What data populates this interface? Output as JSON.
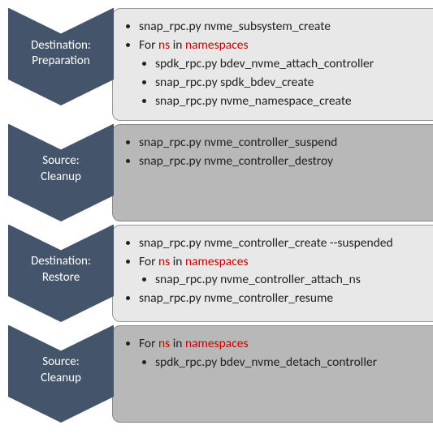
{
  "chevron_fill": "#44546a",
  "steps": [
    {
      "label": "Destination:\nPreparation",
      "box_tone": "light",
      "items": [
        {
          "text": "snap_rpc.py nvme_subsystem_create"
        },
        {
          "text_pre": "For ",
          "red1": "ns",
          "mid": " in ",
          "red2": "namespaces",
          "children": [
            {
              "text": "spdk_rpc.py bdev_nvme_attach_controller"
            },
            {
              "text": "snap_rpc.py spdk_bdev_create"
            },
            {
              "text": "snap_rpc.py nvme_namespace_create"
            }
          ]
        }
      ]
    },
    {
      "label": "Source:\nCleanup",
      "box_tone": "dark",
      "items": [
        {
          "text": "snap_rpc.py nvme_controller_suspend"
        },
        {
          "text": "snap_rpc.py nvme_controller_destroy"
        }
      ]
    },
    {
      "label": "Destination:\nRestore",
      "box_tone": "light",
      "items": [
        {
          "text": "snap_rpc.py nvme_controller_create --suspended"
        },
        {
          "text_pre": "For ",
          "red1": "ns",
          "mid": " in ",
          "red2": "namespaces",
          "children": [
            {
              "text": "snap_rpc.py nvme_controller_attach_ns"
            }
          ]
        },
        {
          "text": "snap_rpc.py nvme_controller_resume"
        }
      ]
    },
    {
      "label": "Source:\nCleanup",
      "box_tone": "dark",
      "items": [
        {
          "text_pre": "For ",
          "red1": "ns",
          "mid": " in ",
          "red2": "namespaces",
          "children": [
            {
              "text": "spdk_rpc.py bdev_nvme_detach_controller"
            }
          ]
        }
      ]
    }
  ]
}
